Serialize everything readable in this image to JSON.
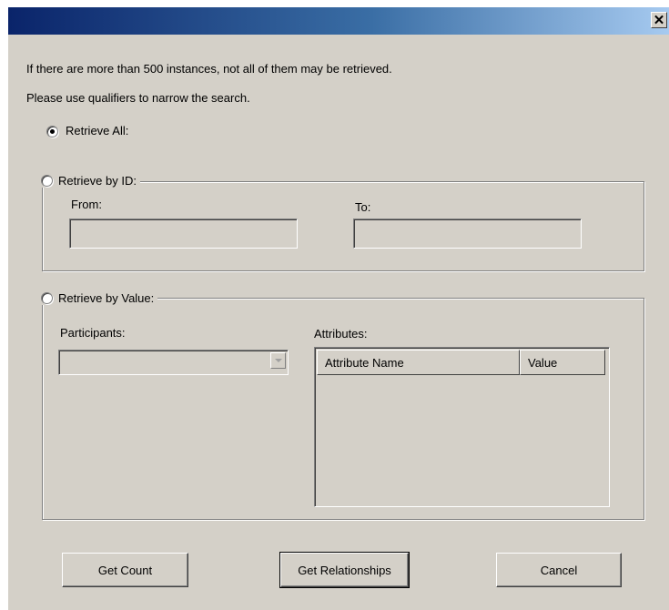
{
  "window": {
    "title": "",
    "close_glyph": "✕"
  },
  "info": {
    "line1": "If there are more than 500 instances, not all of them may be retrieved.",
    "line2": "Please use qualifiers to narrow the search."
  },
  "retrieve_all": {
    "label": "Retrieve All:",
    "selected": true
  },
  "by_id": {
    "label": "Retrieve by ID:",
    "from_label": "From:",
    "from_value": "",
    "to_label": "To:",
    "to_value": ""
  },
  "by_value": {
    "label": "Retrieve by Value:",
    "participants_label": "Participants:",
    "participants_value": "",
    "attributes_label": "Attributes:",
    "columns": [
      "Attribute Name",
      "Value"
    ]
  },
  "buttons": {
    "get_count": "Get Count",
    "get_relationships": "Get Relationships",
    "cancel": "Cancel"
  },
  "colors": {
    "face": "#d4d0c8",
    "title_start": "#0a246a",
    "title_end": "#a6caf0"
  }
}
